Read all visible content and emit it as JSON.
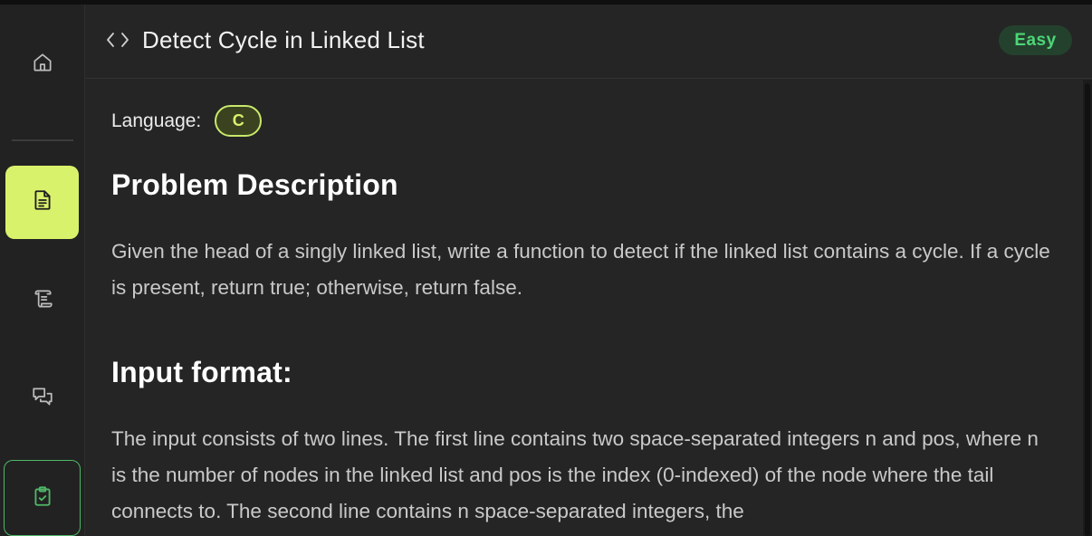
{
  "sidebar": {
    "items": [
      {
        "name": "home",
        "icon": "home-icon"
      },
      {
        "name": "problem",
        "icon": "document-icon",
        "active": true
      },
      {
        "name": "editorial",
        "icon": "scroll-icon"
      },
      {
        "name": "discuss",
        "icon": "chat-bubbles-icon"
      },
      {
        "name": "submissions",
        "icon": "clipboard-check-icon"
      }
    ]
  },
  "header": {
    "icon": "code-brackets-icon",
    "title": "Detect Cycle in Linked List",
    "difficulty": "Easy"
  },
  "content": {
    "language_label": "Language:",
    "language_value": "C",
    "sections": [
      {
        "heading": "Problem Description",
        "text": "Given the head of a singly linked list, write a function to detect if the linked list contains a cycle. If a cycle is present, return true; otherwise, return false."
      },
      {
        "heading": "Input format:",
        "text": "The input consists of two lines. The first line contains two space-separated integers n and pos, where n is the number of nodes in the linked list and pos is the index (0-indexed) of the node where the tail connects to. The second line contains n space-separated integers, the"
      }
    ]
  },
  "colors": {
    "accent": "#d9f26b",
    "easy_text": "#4dd677",
    "easy_bg": "#24412e",
    "submissions_border": "#4fb868",
    "background": "#252525"
  }
}
